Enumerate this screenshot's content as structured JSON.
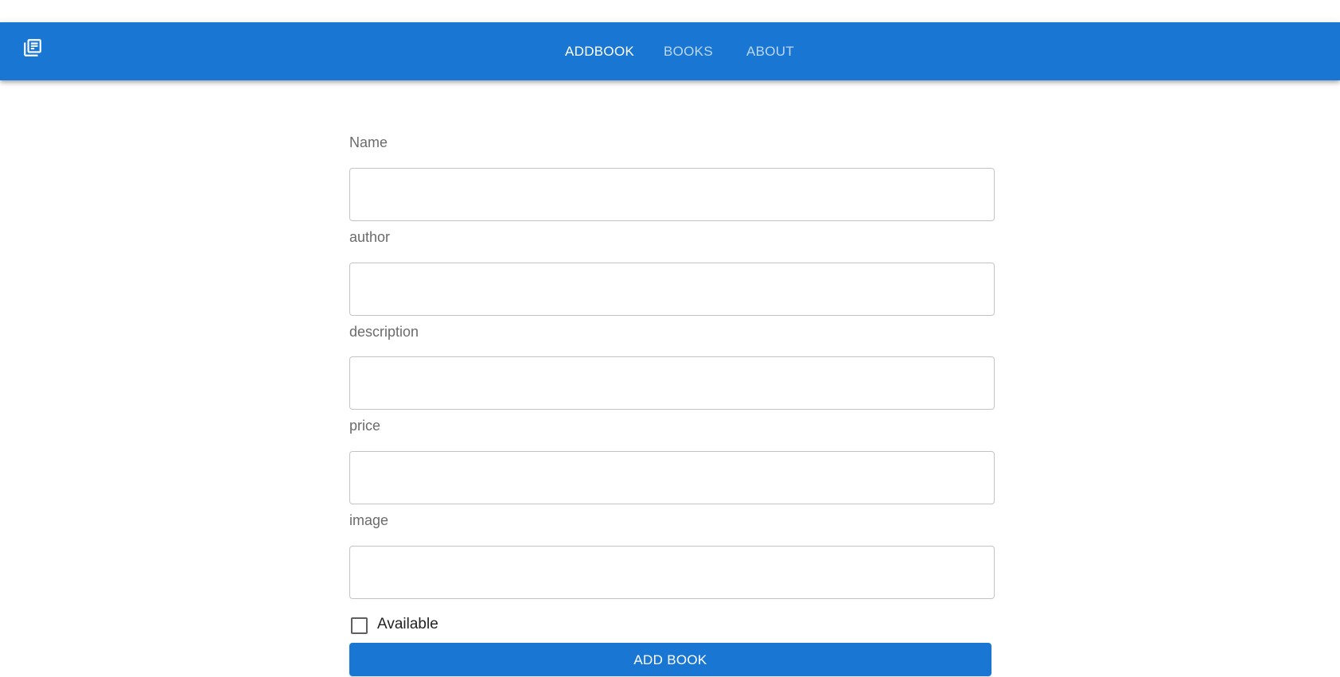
{
  "brand": {
    "icon": "library-books-icon",
    "color": "#1976d2"
  },
  "nav": {
    "tabs": [
      {
        "label": "ADDBOOK",
        "active": true
      },
      {
        "label": "BOOKS",
        "active": false
      },
      {
        "label": "ABOUT",
        "active": false
      }
    ]
  },
  "form": {
    "fields": [
      {
        "label": "Name",
        "value": ""
      },
      {
        "label": "author",
        "value": ""
      },
      {
        "label": "description",
        "value": ""
      },
      {
        "label": "price",
        "value": ""
      },
      {
        "label": "image",
        "value": ""
      }
    ],
    "available": {
      "label": "Available",
      "checked": false
    },
    "submit_label": "ADD BOOK"
  }
}
